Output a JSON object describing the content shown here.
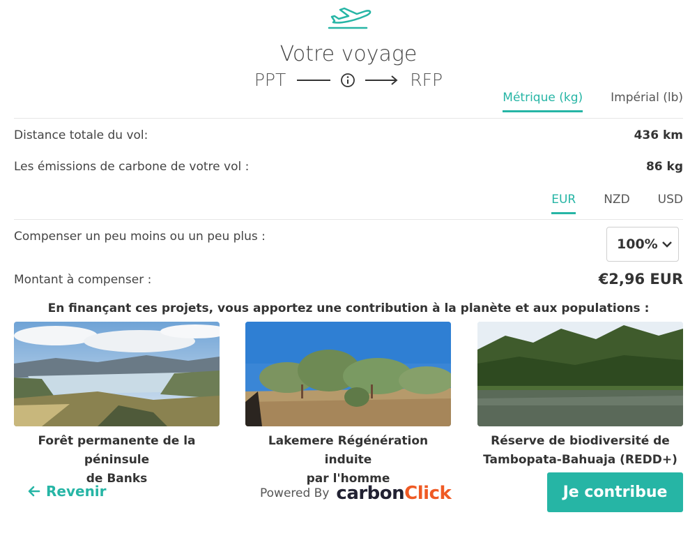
{
  "header": {
    "title": "Votre voyage",
    "origin": "PPT",
    "destination": "RFP"
  },
  "units": {
    "tabs": [
      {
        "label": "Métrique (kg)",
        "active": true
      },
      {
        "label": "Impérial (lb)",
        "active": false
      }
    ]
  },
  "flight": {
    "distance_label": "Distance totale du vol:",
    "distance_value": "436 km",
    "emissions_label": "Les émissions de carbone de votre vol :",
    "emissions_value": "86 kg"
  },
  "currency": {
    "tabs": [
      {
        "label": "EUR",
        "active": true
      },
      {
        "label": "NZD",
        "active": false
      },
      {
        "label": "USD",
        "active": false
      }
    ]
  },
  "offset": {
    "label": "Compenser un peu moins ou un peu plus :",
    "selected": "100%"
  },
  "amount": {
    "label": "Montant à compenser :",
    "value": "€2,96 EUR"
  },
  "projects": {
    "intro": "En finançant ces projets, vous apportez une contribution à la planète et aux populations :",
    "items": [
      {
        "title_line1": "Forêt permanente de la péninsule",
        "title_line2": "de Banks"
      },
      {
        "title_line1": "Lakemere Régénération induite",
        "title_line2": "par l'homme"
      },
      {
        "title_line1": "Réserve de biodiversité de",
        "title_line2": "Tambopata-Bahuaja (REDD+)"
      }
    ]
  },
  "footer": {
    "back_label": "Revenir",
    "powered_by": "Powered By",
    "logo_part1": "carbon",
    "logo_part2": "Click",
    "cta_label": "Je contribue"
  },
  "colors": {
    "accent": "#26b5a5",
    "logo_orange": "#ef5a24"
  },
  "icons": {
    "plane": "airplane-icon",
    "info": "info-icon",
    "chevron": "chevron-down-icon",
    "back": "arrow-left-icon"
  }
}
